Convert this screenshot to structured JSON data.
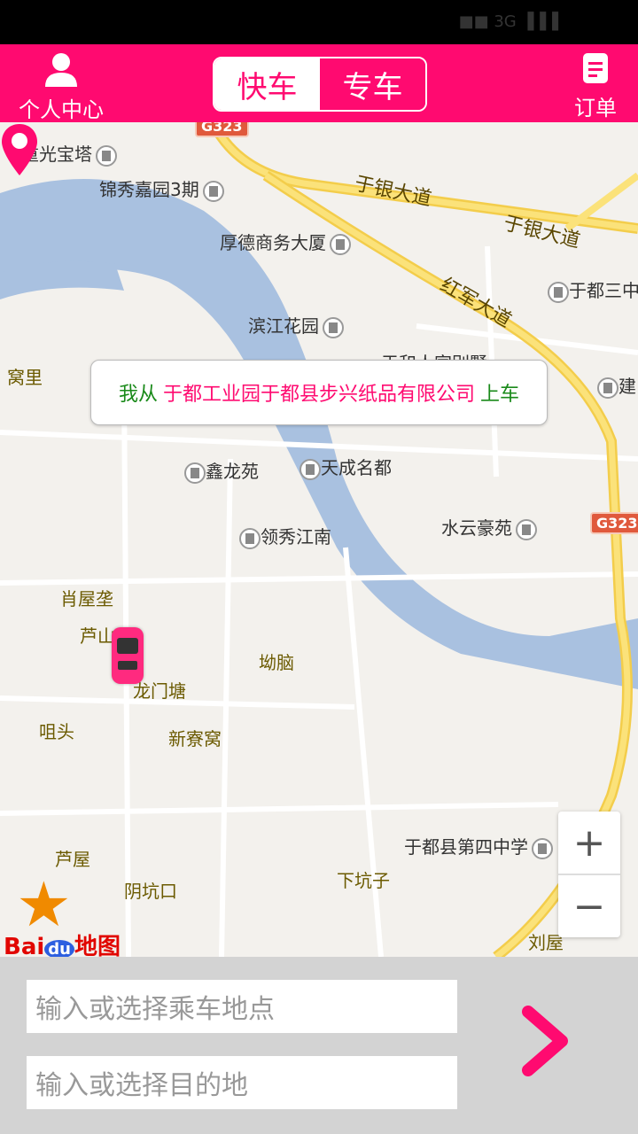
{
  "status": {
    "signal": "■■ 3G ▐▐▐"
  },
  "header": {
    "profile_label": "个人中心",
    "tabs": [
      "快车",
      "专车"
    ],
    "active_tab": "快车",
    "orders_label": "订单",
    "accent": "#ff0a70"
  },
  "map": {
    "route_badges": [
      "G323",
      "G323"
    ],
    "roads": [
      "于银大道",
      "于银大道",
      "红军大道"
    ],
    "pois": [
      "重光宝塔",
      "锦秀嘉园3期",
      "厚德商务大厦",
      "于都三中",
      "滨江花园",
      "于和人家别墅",
      "窝里",
      "建",
      "鑫龙苑",
      "天成名都",
      "领秀江南",
      "水云豪苑",
      "于都县第四中学"
    ],
    "places": [
      "肖屋垄",
      "芦山",
      "坳脑",
      "龙门塘",
      "咀头",
      "新寮窝",
      "芦屋",
      "阴坑口",
      "下坑子",
      "刘屋"
    ],
    "bubble": {
      "prefix": "我从",
      "location": "于都工业园于都县步兴纸品有限公司",
      "suffix": "上车"
    },
    "zoom_in": "+",
    "zoom_out": "−",
    "logo": {
      "bai": "Bai",
      "du": "du",
      "map": "地图"
    }
  },
  "bottom": {
    "pickup_placeholder": "输入或选择乘车地点",
    "destination_placeholder": "输入或选择目的地",
    "next_icon": "chevron-right-icon"
  }
}
